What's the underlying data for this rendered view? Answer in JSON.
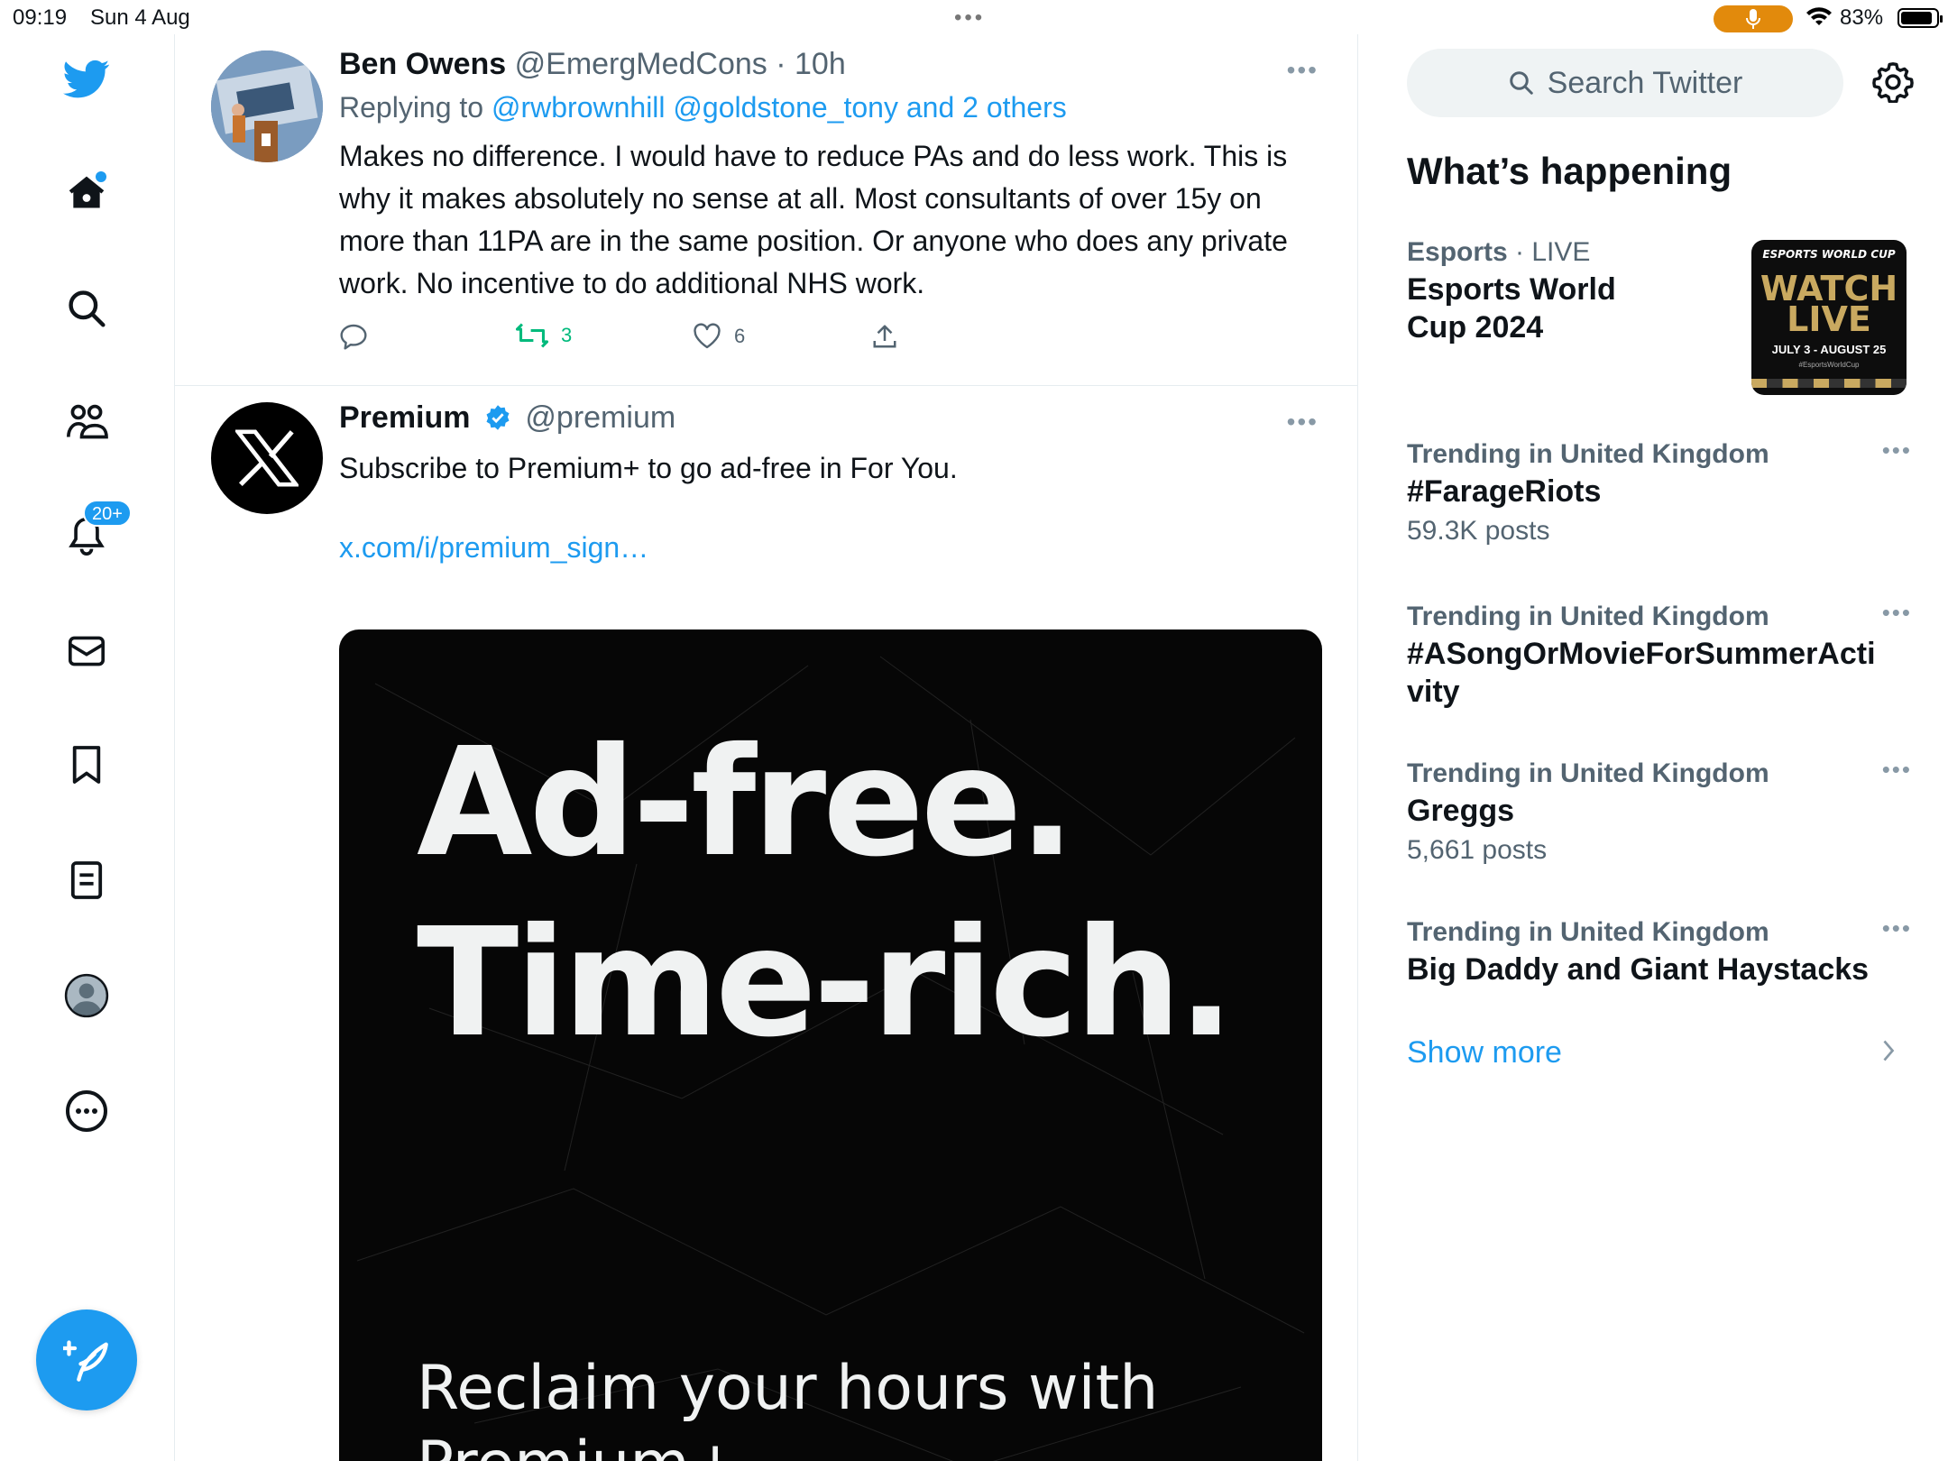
{
  "status_bar": {
    "time": "09:19",
    "date": "Sun 4 Aug",
    "battery_percent": "83%",
    "mic_color": "#e28a0c"
  },
  "nav": {
    "items": [
      {
        "icon": "twitter-bird-icon"
      },
      {
        "icon": "home-icon"
      },
      {
        "icon": "search-icon"
      },
      {
        "icon": "communities-icon"
      },
      {
        "icon": "bell-icon"
      },
      {
        "icon": "mail-icon"
      },
      {
        "icon": "bookmark-icon"
      },
      {
        "icon": "lists-icon"
      },
      {
        "icon": "profile-icon"
      },
      {
        "icon": "more-circle-icon"
      }
    ],
    "notifications_badge": "20+",
    "accent": "#1d9bf0"
  },
  "tweets": [
    {
      "name": "Ben Owens",
      "handle": "@EmergMedCons",
      "time": "· 10h",
      "reply_prefix": "Replying to",
      "reply_mentions": "@rwbrownhill @goldstone_tony and 2 others",
      "text": "Makes no difference.  I would have to reduce PAs and do less work. This is why it makes absolutely no sense at all. Most consultants of over 15y on more than 11PA are in the same position. Or anyone who does any private work. No incentive to do additional NHS work.",
      "retweets": "3",
      "likes": "6"
    },
    {
      "name": "Premium",
      "handle": "@premium",
      "text": "Subscribe to Premium+ to go ad-free in For You.",
      "link": "x.com/i/premium_sign…",
      "card": {
        "line1": "Ad-free.",
        "line2": "Time-rich.",
        "sub_line1": "Reclaim your hours with",
        "sub_line2": "Premium+"
      }
    }
  ],
  "sidebar": {
    "search_placeholder": "Search Twitter",
    "section_title": "What’s happening",
    "esports": {
      "category": "Esports",
      "status": "· LIVE",
      "title": "Esports World Cup 2024",
      "thumb_top": "ESPORTS WORLD CUP",
      "thumb_main1": "WATCH",
      "thumb_main2": "LIVE",
      "thumb_dates": "JULY 3 - AUGUST 25",
      "thumb_tag": "#EsportsWorldCup"
    },
    "trends": [
      {
        "meta": "Trending in United Kingdom",
        "name": "#FarageRiots",
        "count": "59.3K posts"
      },
      {
        "meta": "Trending in United Kingdom",
        "name": "#ASongOrMovieForSummerActivity",
        "count": ""
      },
      {
        "meta": "Trending in United Kingdom",
        "name": "Greggs",
        "count": "5,661 posts"
      },
      {
        "meta": "Trending in United Kingdom",
        "name": "Big Daddy and Giant Haystacks",
        "count": ""
      }
    ],
    "show_more": "Show more"
  }
}
